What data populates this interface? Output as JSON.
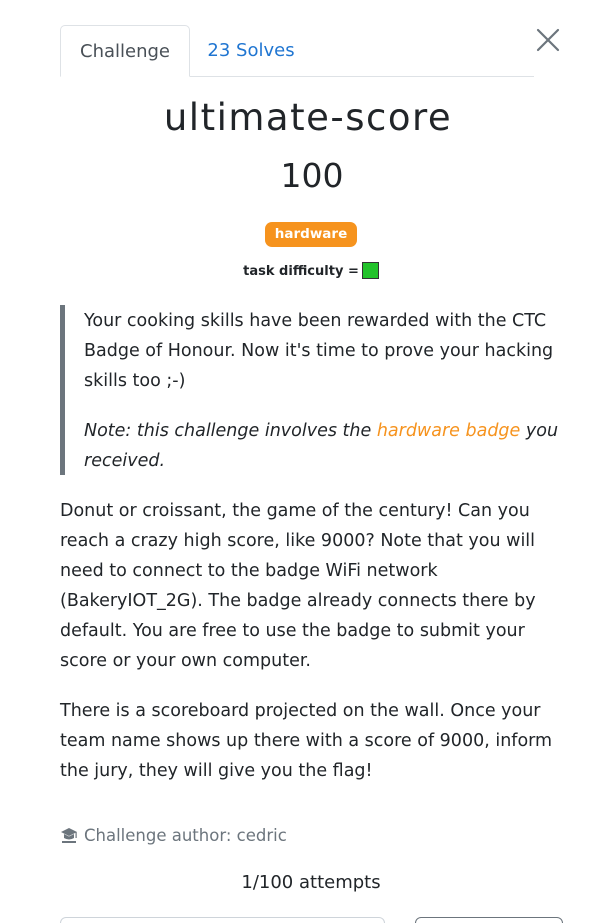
{
  "tabs": {
    "challenge_label": "Challenge",
    "solves_label": "23 Solves"
  },
  "challenge": {
    "name": "ultimate-score",
    "points": "100",
    "tag": "hardware",
    "difficulty_label": "task difficulty =",
    "difficulty_color": "#22c22a"
  },
  "quote": {
    "text": "Your cooking skills have been rewarded with the CTC Badge of Honour. Now it's time to prove your hacking skills too ;-)",
    "note_prefix": "Note: this challenge involves the ",
    "note_link": "hardware badge",
    "note_suffix": " you received."
  },
  "description": {
    "p1": "Donut or croissant, the game of the century! Can you reach a crazy high score, like 9000? Note that you will need to connect to the badge WiFi network (BakeryIOT_2G). The badge already connects there by default. You are free to use the badge to submit your score or your own computer.",
    "p2": "There is a scoreboard projected on the wall. Once your team name shows up there with a score of 9000, inform the jury, they will give you the flag!"
  },
  "author": {
    "icon": "graduation-cap-icon",
    "text": "Challenge author: cedric"
  },
  "attempts": "1/100 attempts",
  "colors": {
    "accent": "#f6931e",
    "link_blue": "#1f75d1",
    "muted": "#6c757d"
  }
}
